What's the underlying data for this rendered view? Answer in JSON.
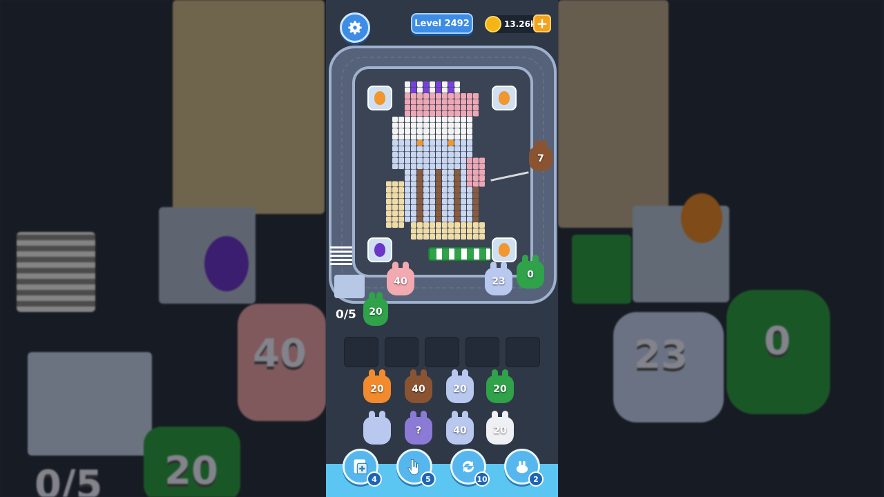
{
  "hud": {
    "level_label": "Level 2492",
    "coins_value": "13.26k",
    "coins_add": "+"
  },
  "conveyor": {
    "bunnies": [
      {
        "value": "40",
        "color": "#f3a9b0"
      },
      {
        "value": "23",
        "color": "#b9c8ee"
      },
      {
        "value": "0",
        "color": "#2fa24a"
      },
      {
        "value": "7",
        "color": "#8a5432"
      }
    ],
    "queue_bunny": {
      "value": "20",
      "color": "#2fa24a"
    },
    "counter": "0/5"
  },
  "pixel_art_palette": {
    "white": "#f4f4f4",
    "pink": "#eea7b5",
    "lavender": "#c9d6f0",
    "beige": "#f0dca7",
    "brown": "#8a5b3c",
    "purple": "#7b3fe0",
    "orange": "#f2962e"
  },
  "holding_slots": [
    "",
    "",
    "",
    "",
    ""
  ],
  "bunny_grid": [
    [
      {
        "value": "20",
        "color": "#f28a2e"
      },
      {
        "value": "40",
        "color": "#8a5432"
      },
      {
        "value": "20",
        "color": "#b9c8ee"
      },
      {
        "value": "20",
        "color": "#2fa24a"
      }
    ],
    [
      {
        "value": "",
        "color": "#b9c8ee"
      },
      {
        "value": "?",
        "color": "#8b7ad6"
      },
      {
        "value": "40",
        "color": "#b9c8ee"
      },
      {
        "value": "20",
        "color": "#eef0f4"
      }
    ]
  ],
  "tools": [
    {
      "name": "add-slot",
      "count": "4"
    },
    {
      "name": "hand-pick",
      "count": "5"
    },
    {
      "name": "shuffle",
      "count": "10"
    },
    {
      "name": "bunny-magnet",
      "count": "2"
    }
  ],
  "background": {
    "left_number": "40",
    "left_counter": "0/5",
    "left_green_number": "20",
    "right_number": "23",
    "right_green_number": "0"
  }
}
